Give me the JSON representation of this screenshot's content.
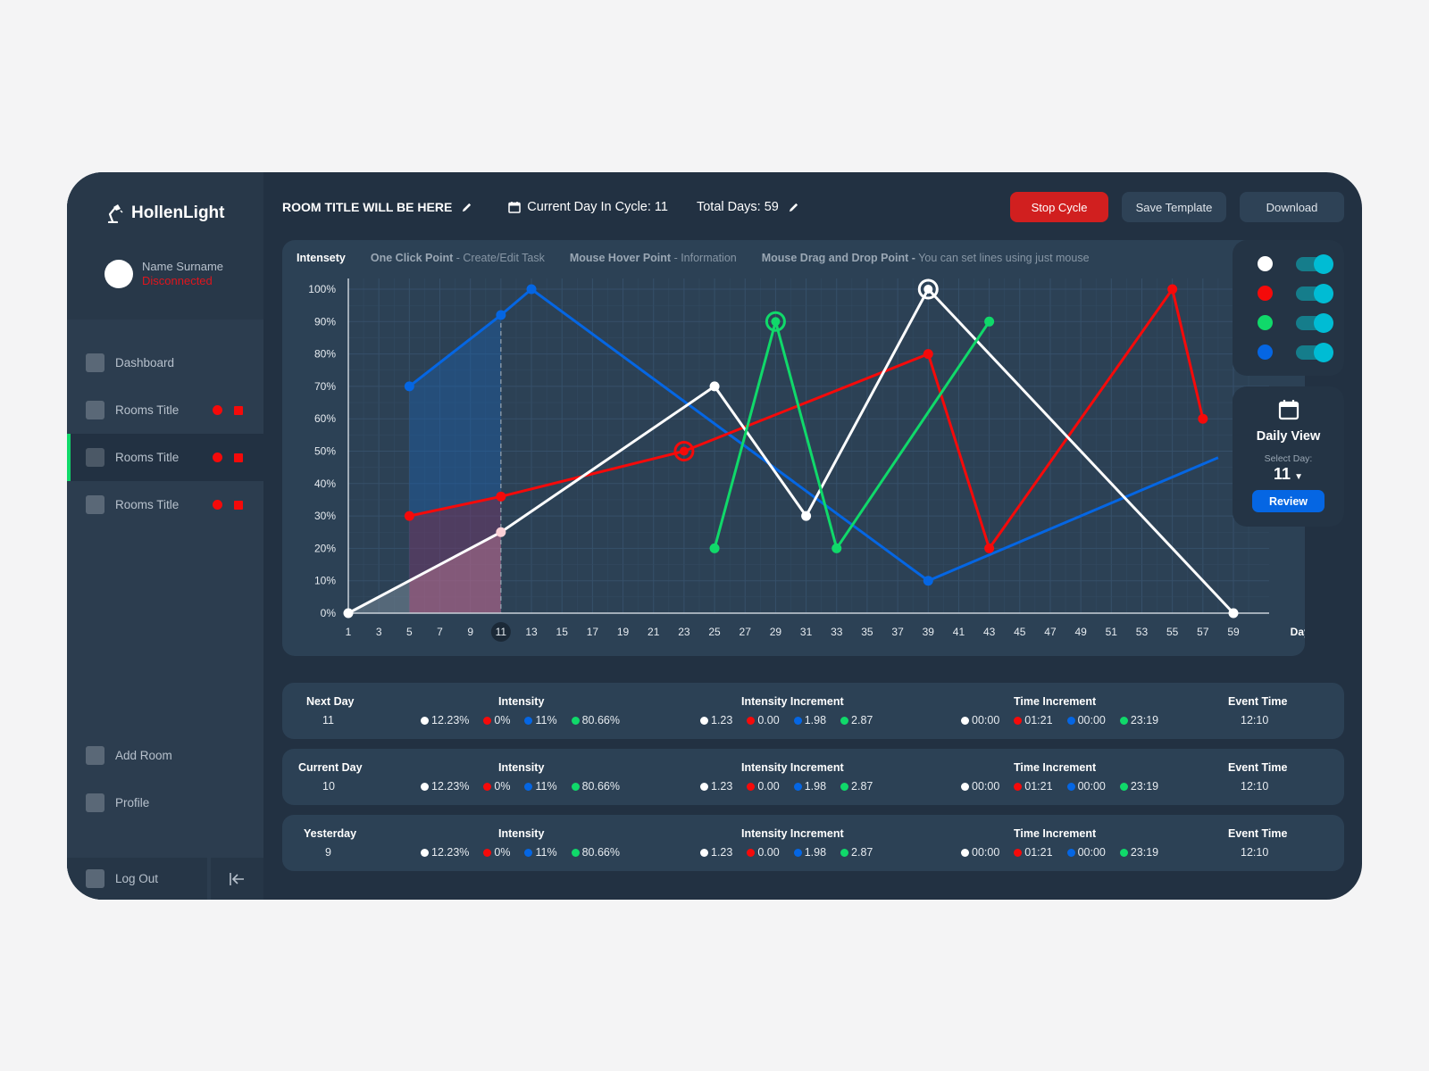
{
  "app": {
    "brand": "HollenLight",
    "user": {
      "name": "Name Surname",
      "status": "Disconnected"
    }
  },
  "sidebar": {
    "items": [
      {
        "label": "Dashboard",
        "indicators": false,
        "active": false
      },
      {
        "label": "Rooms Title",
        "indicators": true,
        "active": false
      },
      {
        "label": "Rooms Title",
        "indicators": true,
        "active": true
      },
      {
        "label": "Rooms Title",
        "indicators": true,
        "active": false
      }
    ],
    "bottom_items": [
      {
        "label": "Add Room"
      },
      {
        "label": "Profile"
      }
    ],
    "logout_label": "Log Out",
    "collapse_icon": "collapse-left-icon"
  },
  "header": {
    "room_title": "ROOM TITLE WILL BE HERE",
    "current_day_label": "Current Day In Cycle: 11",
    "total_days_label": "Total Days: 59",
    "buttons": {
      "stop": "Stop Cycle",
      "save": "Save Template",
      "download": "Download"
    }
  },
  "chart_help": {
    "title": "Intensety",
    "hints": [
      {
        "bold": "One Click Point",
        "desc": " - Create/Edit Task"
      },
      {
        "bold": "Mouse Hover Point",
        "desc": " - Information"
      },
      {
        "bold": "Mouse Drag and Drop Point -",
        "desc": " You can set lines using just mouse"
      }
    ]
  },
  "colors": {
    "white": "#ffffff",
    "red": "#f50a0a",
    "green": "#10d96a",
    "blue": "#0566e3",
    "accent_toggle": "#00bcd4",
    "stop": "#d11f1f"
  },
  "legend": [
    {
      "series": "white",
      "color": "#ffffff",
      "enabled": true
    },
    {
      "series": "red",
      "color": "#f50a0a",
      "enabled": true
    },
    {
      "series": "green",
      "color": "#10d96a",
      "enabled": true
    },
    {
      "series": "blue",
      "color": "#0566e3",
      "enabled": true
    }
  ],
  "daily_view": {
    "title": "Daily View",
    "select_label": "Select Day:",
    "selected_day": "11",
    "review_label": "Review"
  },
  "chart_data": {
    "type": "line",
    "title": "Intensety",
    "xlabel": "Days",
    "ylabel": "",
    "x_ticks": [
      1,
      3,
      5,
      7,
      9,
      11,
      13,
      15,
      17,
      19,
      21,
      23,
      25,
      27,
      29,
      31,
      33,
      35,
      37,
      39,
      41,
      43,
      45,
      47,
      49,
      51,
      53,
      55,
      57,
      59
    ],
    "highlighted_x": 11,
    "y_ticks": [
      "0%",
      "10%",
      "20%",
      "30%",
      "40%",
      "50%",
      "60%",
      "70%",
      "80%",
      "90%",
      "100%"
    ],
    "xlim": [
      1,
      59
    ],
    "ylim": [
      0,
      100
    ],
    "grid": true,
    "series": [
      {
        "name": "white",
        "color": "#ffffff",
        "points": [
          [
            1,
            0
          ],
          [
            11,
            25
          ],
          [
            25,
            70
          ],
          [
            31,
            30
          ],
          [
            39,
            100
          ],
          [
            59,
            0
          ]
        ],
        "highlight": [
          39,
          100
        ]
      },
      {
        "name": "red",
        "color": "#f50a0a",
        "points": [
          [
            5,
            30
          ],
          [
            11,
            36
          ],
          [
            23,
            50
          ],
          [
            39,
            80
          ],
          [
            43,
            20
          ],
          [
            55,
            100
          ],
          [
            57,
            60
          ]
        ],
        "highlight": [
          23,
          50
        ]
      },
      {
        "name": "blue",
        "color": "#0566e3",
        "points": [
          [
            5,
            70
          ],
          [
            11,
            92
          ],
          [
            13,
            100
          ],
          [
            39,
            10
          ],
          [
            58,
            48
          ]
        ],
        "highlight": null
      },
      {
        "name": "green",
        "color": "#10d96a",
        "points": [
          [
            25,
            20
          ],
          [
            29,
            90
          ],
          [
            33,
            20
          ],
          [
            43,
            90
          ]
        ],
        "highlight": [
          29,
          90
        ]
      }
    ],
    "shaded_range": [
      5,
      11
    ],
    "current_day_marker": 11
  },
  "stats": [
    {
      "day_label": "Next Day",
      "day": "11",
      "intensity_label": "Intensity",
      "intensity": [
        "12.23%",
        "0%",
        "11%",
        "80.66%"
      ],
      "increment_label": "Intensity Increment",
      "increment": [
        "1.23",
        "0.00",
        "1.98",
        "2.87"
      ],
      "time_label": "Time Increment",
      "time": [
        "00:00",
        "01:21",
        "00:00",
        "23:19"
      ],
      "event_label": "Event Time",
      "event": "12:10"
    },
    {
      "day_label": "Current Day",
      "day": "10",
      "intensity_label": "Intensity",
      "intensity": [
        "12.23%",
        "0%",
        "11%",
        "80.66%"
      ],
      "increment_label": "Intensity Increment",
      "increment": [
        "1.23",
        "0.00",
        "1.98",
        "2.87"
      ],
      "time_label": "Time Increment",
      "time": [
        "00:00",
        "01:21",
        "00:00",
        "23:19"
      ],
      "event_label": "Event Time",
      "event": "12:10"
    },
    {
      "day_label": "Yesterday",
      "day": "9",
      "intensity_label": "Intensity",
      "intensity": [
        "12.23%",
        "0%",
        "11%",
        "80.66%"
      ],
      "increment_label": "Intensity Increment",
      "increment": [
        "1.23",
        "0.00",
        "1.98",
        "2.87"
      ],
      "time_label": "Time Increment",
      "time": [
        "00:00",
        "01:21",
        "00:00",
        "23:19"
      ],
      "event_label": "Event Time",
      "event": "12:10"
    }
  ]
}
